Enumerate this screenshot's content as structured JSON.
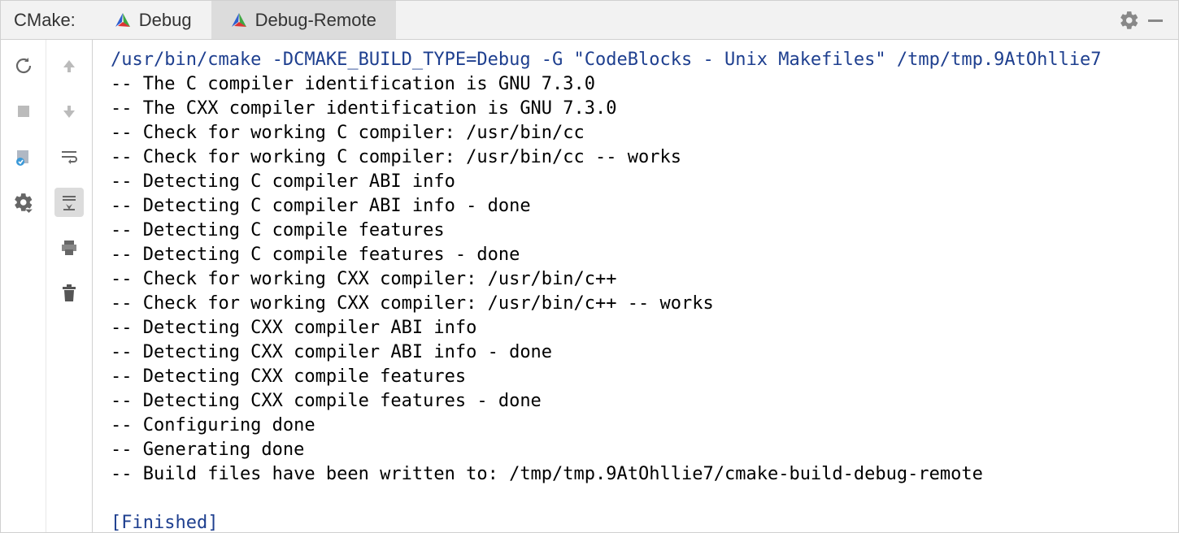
{
  "header": {
    "title": "CMake:",
    "tabs": [
      {
        "label": "Debug",
        "active": false
      },
      {
        "label": "Debug-Remote",
        "active": true
      }
    ]
  },
  "console": {
    "command": "/usr/bin/cmake -DCMAKE_BUILD_TYPE=Debug -G \"CodeBlocks - Unix Makefiles\" /tmp/tmp.9AtOhllie7",
    "lines": [
      "-- The C compiler identification is GNU 7.3.0",
      "-- The CXX compiler identification is GNU 7.3.0",
      "-- Check for working C compiler: /usr/bin/cc",
      "-- Check for working C compiler: /usr/bin/cc -- works",
      "-- Detecting C compiler ABI info",
      "-- Detecting C compiler ABI info - done",
      "-- Detecting C compile features",
      "-- Detecting C compile features - done",
      "-- Check for working CXX compiler: /usr/bin/c++",
      "-- Check for working CXX compiler: /usr/bin/c++ -- works",
      "-- Detecting CXX compiler ABI info",
      "-- Detecting CXX compiler ABI info - done",
      "-- Detecting CXX compile features",
      "-- Detecting CXX compile features - done",
      "-- Configuring done",
      "-- Generating done",
      "-- Build files have been written to: /tmp/tmp.9AtOhllie7/cmake-build-debug-remote"
    ],
    "status": "[Finished]"
  }
}
